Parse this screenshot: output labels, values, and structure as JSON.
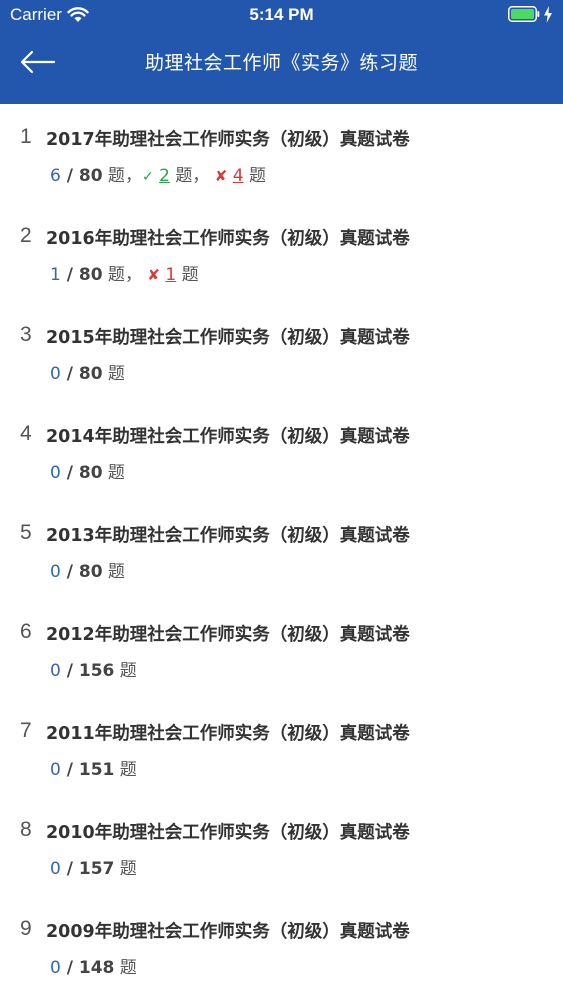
{
  "status_bar": {
    "carrier": "Carrier",
    "time": "5:14 PM",
    "wifi_icon": "wifi-icon",
    "battery_icon": "battery-icon",
    "charging_icon": "bolt-icon"
  },
  "nav": {
    "title": "助理社会工作师《实务》练习题",
    "back_icon": "arrow-left-icon"
  },
  "colors": {
    "header_bg": "#2357ae",
    "done_blue": "#3667a8",
    "correct_green": "#2aa44a",
    "wrong_red": "#d63a3a"
  },
  "exams": [
    {
      "index": "1",
      "name": "2017年助理社会工作师实务（初级）真题试卷",
      "done": "6",
      "total": " / 80",
      "unit": " 题",
      "sep1": "，",
      "correct_mark": "✓",
      "correct": "2",
      "sep2": "题，",
      "wrong_mark": "✘",
      "wrong": "4",
      "tail": "题"
    },
    {
      "index": "2",
      "name": "2016年助理社会工作师实务（初级）真题试卷",
      "done": "1",
      "total": " / 80",
      "unit": " 题",
      "sep1": "，",
      "wrong_mark": "✘",
      "wrong": "1",
      "tail": "题"
    },
    {
      "index": "3",
      "name": "2015年助理社会工作师实务（初级）真题试卷",
      "done": "0",
      "total": " / 80",
      "unit": " 题"
    },
    {
      "index": "4",
      "name": "2014年助理社会工作师实务（初级）真题试卷",
      "done": "0",
      "total": " / 80",
      "unit": " 题"
    },
    {
      "index": "5",
      "name": "2013年助理社会工作师实务（初级）真题试卷",
      "done": "0",
      "total": " / 80",
      "unit": " 题"
    },
    {
      "index": "6",
      "name": "2012年助理社会工作师实务（初级）真题试卷",
      "done": "0",
      "total": " / 156",
      "unit": " 题"
    },
    {
      "index": "7",
      "name": "2011年助理社会工作师实务（初级）真题试卷",
      "done": "0",
      "total": " / 151",
      "unit": " 题"
    },
    {
      "index": "8",
      "name": "2010年助理社会工作师实务（初级）真题试卷",
      "done": "0",
      "total": " / 157",
      "unit": " 题"
    },
    {
      "index": "9",
      "name": "2009年助理社会工作师实务（初级）真题试卷",
      "done": "0",
      "total": " / 148",
      "unit": " 题"
    }
  ]
}
